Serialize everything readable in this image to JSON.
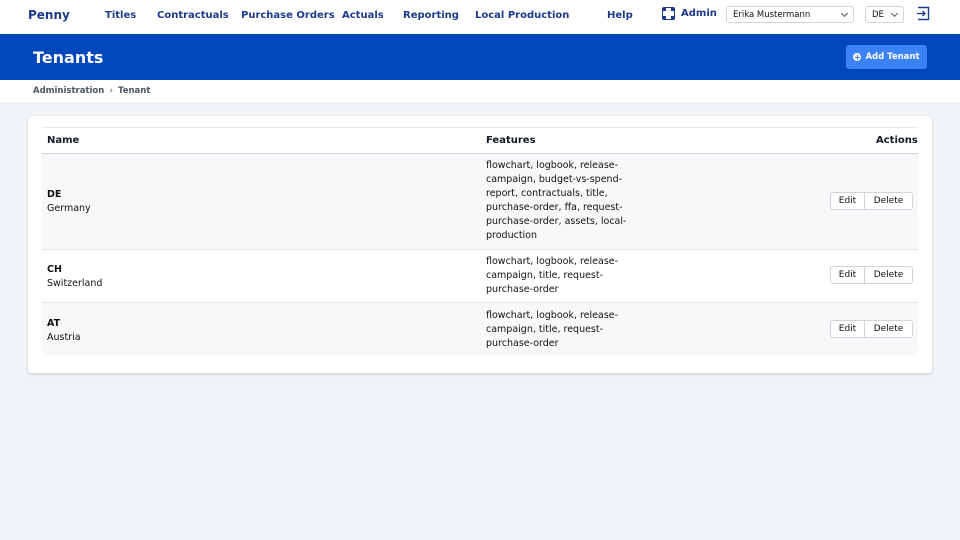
{
  "nav": {
    "brand": "Penny",
    "links": [
      "Titles",
      "Contractuals",
      "Purchase Orders",
      "Actuals",
      "Reporting",
      "Local Production"
    ],
    "help": "Help",
    "admin_label": "Admin",
    "user_select": "Erika Mustermann",
    "lang_select": "DE"
  },
  "header": {
    "title": "Tenants",
    "add_button": "Add Tenant"
  },
  "breadcrumb": {
    "items": [
      "Administration",
      "Tenant"
    ]
  },
  "table": {
    "columns": [
      "Name",
      "Features",
      "Actions"
    ],
    "rows": [
      {
        "code": "DE",
        "name": "Germany",
        "features": "flowchart, logbook, release-campaign, budget-vs-spend-report, contractuals, title, purchase-order, ffa, request-purchase-order, assets, local-production"
      },
      {
        "code": "CH",
        "name": "Switzerland",
        "features": "flowchart, logbook, release-campaign, title, request-purchase-order"
      },
      {
        "code": "AT",
        "name": "Austria",
        "features": "flowchart, logbook, release-campaign, title, request-purchase-order"
      }
    ],
    "edit_label": "Edit",
    "delete_label": "Delete"
  },
  "colors": {
    "brand_blue": "#0047bb",
    "nav_text": "#1e3a8a",
    "accent_button": "#3b82f6"
  },
  "icons": [
    "admin-icon",
    "chevron-down-icon",
    "logout-icon",
    "plus-circle-icon",
    "chevron-right-icon"
  ]
}
